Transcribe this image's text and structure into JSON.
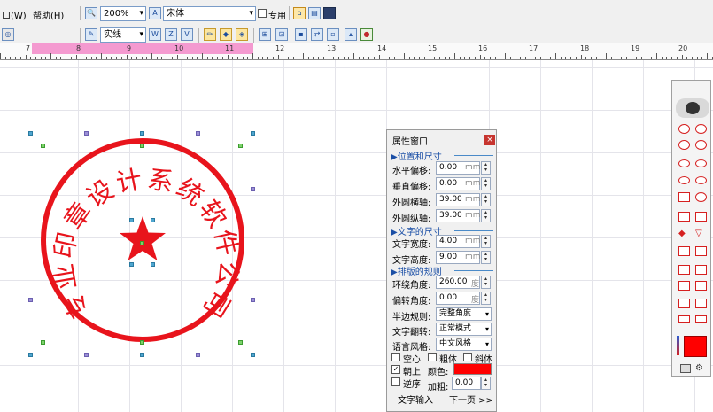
{
  "menu": {
    "window": "口(W)",
    "help": "帮助(H)"
  },
  "toolbar": {
    "zoom": "200%",
    "font": "宋体",
    "exclusive_label": "专用",
    "line_style": "实线"
  },
  "ruler": {
    "labels": [
      "7",
      "8",
      "9",
      "10",
      "11",
      "12",
      "13",
      "14",
      "15",
      "16",
      "17",
      "18",
      "19",
      "20"
    ]
  },
  "seal": {
    "text": "专业印章设计系统软件公司",
    "color": "#e8141c"
  },
  "panel": {
    "title": "属性窗口",
    "close": "×",
    "sec_position": "▶位置和尺寸",
    "h_offset_label": "水平偏移:",
    "h_offset_value": "0.00",
    "v_offset_label": "垂直偏移:",
    "v_offset_value": "0.00",
    "outer_h_label": "外圆横轴:",
    "outer_h_value": "39.00",
    "outer_v_label": "外圆纵轴:",
    "outer_v_value": "39.00",
    "unit_mm": "mm",
    "sec_text_size": "▶文字的尺寸",
    "text_width_label": "文字宽度:",
    "text_width_value": "4.00",
    "text_height_label": "文字高度:",
    "text_height_value": "9.00",
    "sec_layout": "▶排版的规则",
    "wrap_angle_label": "环绕角度:",
    "wrap_angle_value": "260.00",
    "rotate_angle_label": "偏转角度:",
    "rotate_angle_value": "0.00",
    "unit_deg": "度",
    "half_rule_label": "半边规则:",
    "half_rule_value": "完整角度",
    "text_flip_label": "文字翻转:",
    "text_flip_value": "正常模式",
    "lang_style_label": "语言风格:",
    "lang_style_value": "中文风格",
    "hollow": "空心",
    "bold": "粗体",
    "italic": "斜体",
    "upward": "朝上",
    "color_label": "颜色:",
    "reverse": "逆序",
    "thicken_label": "加粗:",
    "thicken_value": "0.00",
    "text_input": "文字输入",
    "next_page": "下一页 >>",
    "swatch_color": "#ff0000"
  }
}
